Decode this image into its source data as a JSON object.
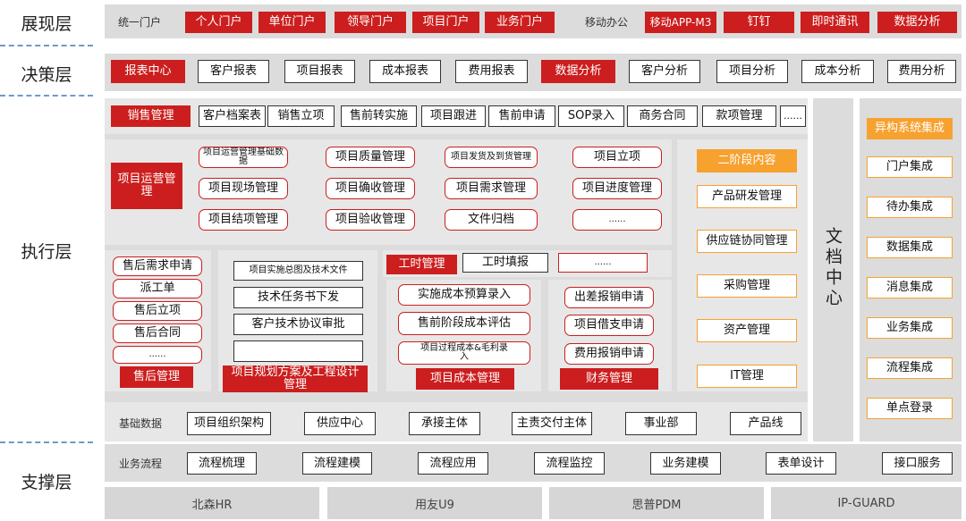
{
  "layers": {
    "present": "展现层",
    "decision": "决策层",
    "execute": "执行层",
    "support": "支撑层"
  },
  "present": {
    "unified_label": "统一门户",
    "portals": [
      "个人门户",
      "单位门户",
      "领导门户",
      "项目门户",
      "业务门户"
    ],
    "mobile_label": "移动办公",
    "mobile": [
      "移动APP-M3",
      "钉钉",
      "即时通讯",
      "数据分析"
    ]
  },
  "decision": {
    "items": [
      "报表中心",
      "客户报表",
      "项目报表",
      "成本报表",
      "费用报表",
      "数据分析",
      "客户分析",
      "项目分析",
      "成本分析",
      "费用分析"
    ]
  },
  "sales": {
    "title": "销售管理",
    "items": [
      "客户档案表",
      "销售立项",
      "售前转实施",
      "项目跟进",
      "售前申请",
      "SOP录入",
      "商务合同",
      "款项管理",
      "......"
    ]
  },
  "project_ops": {
    "title": "项目运营管理",
    "items": [
      "项目运营管理基础数据",
      "项目质量管理",
      "项目发货及到货管理",
      "项目立项",
      "项目现场管理",
      "项目确收管理",
      "项目需求管理",
      "项目进度管理",
      "项目结项管理",
      "项目验收管理",
      "文件归档",
      "......"
    ]
  },
  "after_sales": {
    "title": "售后管理",
    "items": [
      "售后需求申请",
      "派工单",
      "售后立项",
      "售后合同",
      "......"
    ]
  },
  "planning": {
    "title": "项目规划方案及工程设计管理",
    "items": [
      "项目实施总图及技术文件",
      "技术任务书下发",
      "客户技术协议审批",
      ""
    ]
  },
  "worktime": {
    "title": "工时管理",
    "items": [
      "工时填报",
      "......"
    ]
  },
  "cost": {
    "title": "项目成本管理",
    "items": [
      "实施成本预算录入",
      "售前阶段成本评估",
      "项目过程成本&毛利录入"
    ]
  },
  "finance": {
    "title": "财务管理",
    "items": [
      "出差报销申请",
      "项目借支申请",
      "费用报销申请"
    ]
  },
  "phase2": {
    "title": "二阶段内容",
    "items": [
      "产品研发管理",
      "供应链协同管理",
      "采购管理",
      "资产管理",
      "IT管理"
    ]
  },
  "doc_center": "文档中心",
  "heterogeneous": {
    "title": "异构系统集成",
    "items": [
      "门户集成",
      "待办集成",
      "数据集成",
      "消息集成",
      "业务集成",
      "流程集成",
      "单点登录"
    ]
  },
  "basic_data": {
    "label": "基础数据",
    "items": [
      "项目组织架构",
      "供应中心",
      "承接主体",
      "主责交付主体",
      "事业部",
      "产品线"
    ]
  },
  "biz_flow": {
    "label": "业务流程",
    "items": [
      "流程梳理",
      "流程建模",
      "流程应用",
      "流程监控",
      "业务建模",
      "表单设计",
      "接口服务"
    ]
  },
  "systems": [
    "北森HR",
    "用友U9",
    "思普PDM",
    "IP-GUARD"
  ],
  "colors": {
    "red": "#cc1e1e",
    "orange": "#f7a12f",
    "gray": "#dcdcdc"
  }
}
